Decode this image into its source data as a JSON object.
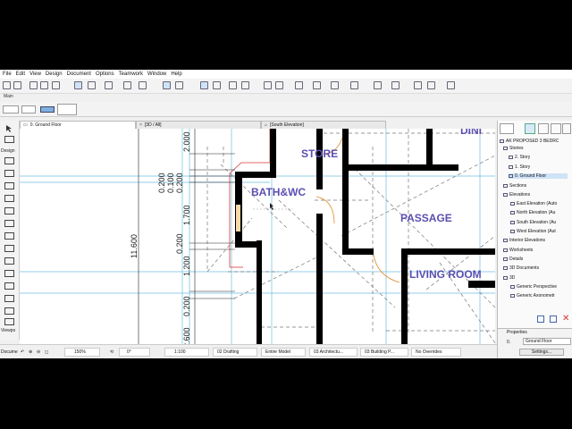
{
  "menu": [
    "File",
    "Edit",
    "View",
    "Design",
    "Document",
    "Options",
    "Teamwork",
    "Window",
    "Help"
  ],
  "toolbar_label": "Main",
  "tabs": [
    {
      "label": "0. Ground Floor"
    },
    {
      "label": "[3D / All]"
    },
    {
      "label": "[South Elevation]"
    }
  ],
  "toolbox": {
    "label_design": "Design",
    "label_viewpoint": "Viewpo",
    "label_document": "Docume"
  },
  "drawing": {
    "rooms": [
      "STORE",
      "BATH&WC",
      "PASSAGE",
      "LIVING ROOM",
      "DINI"
    ],
    "dims_left": [
      "2.000",
      "0.200",
      "0.100",
      "0.200",
      "1.700",
      "0.200",
      "1.200",
      "0.200",
      "2.600"
    ],
    "dim_total": "11.600"
  },
  "navigator": {
    "project": "AK PROPOSED 3 BEDRC",
    "items": [
      {
        "label": "Stories",
        "level": 1
      },
      {
        "label": "2. Story",
        "level": 2
      },
      {
        "label": "1. Story",
        "level": 2
      },
      {
        "label": "0. Ground Floor",
        "level": 2,
        "selected": true
      },
      {
        "label": "Sections",
        "level": 1
      },
      {
        "label": "Elevations",
        "level": 1
      },
      {
        "label": "East Elevation (Auto",
        "level": 2
      },
      {
        "label": "North Elevation (Au",
        "level": 2
      },
      {
        "label": "South Elevation (Au",
        "level": 2
      },
      {
        "label": "West Elevation (Aut",
        "level": 2
      },
      {
        "label": "Interior Elevations",
        "level": 1
      },
      {
        "label": "Worksheets",
        "level": 1
      },
      {
        "label": "Details",
        "level": 1
      },
      {
        "label": "3D Documents",
        "level": 1
      },
      {
        "label": "3D",
        "level": 1
      },
      {
        "label": "Generic Perspective",
        "level": 2
      },
      {
        "label": "Generic Axonometr",
        "level": 2
      }
    ]
  },
  "properties": {
    "title": "Properties",
    "id": "0.",
    "value": "Ground Floor",
    "settings_label": "Settings..."
  },
  "status": {
    "zoom": "150%",
    "angle": "0°",
    "scale": "1:100",
    "layer_combo": "02 Drafting",
    "model_view": "Entire Model",
    "pen_set": "03 Architectu...",
    "mvo": "03 Building P...",
    "overrides": "No Overrides"
  },
  "colors": {
    "room_label": "#5a4fb0",
    "wall": "#000000",
    "dim": "#1a1a1a",
    "guide": "#6fbde0",
    "door": "#e09030",
    "accent": "#d33"
  }
}
